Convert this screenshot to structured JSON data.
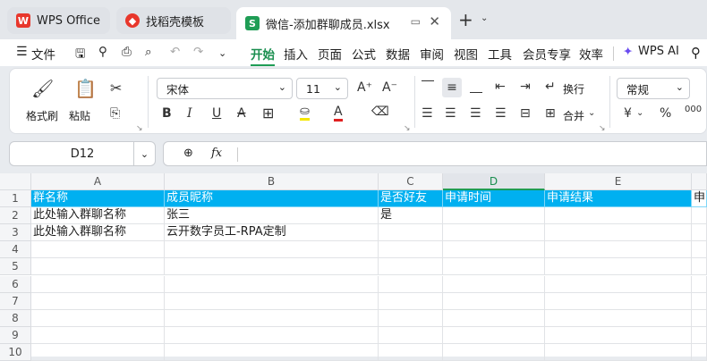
{
  "tabs": [
    {
      "label": "WPS Office",
      "icon": "wps-logo-icon"
    },
    {
      "label": "找稻壳模板",
      "icon": "docer-icon"
    },
    {
      "label": "微信-添加群聊成员.xlsx",
      "icon": "spreadsheet-icon",
      "icon_letter": "S"
    }
  ],
  "menu": {
    "file": "文件",
    "items": [
      "开始",
      "插入",
      "页面",
      "公式",
      "数据",
      "审阅",
      "视图",
      "工具",
      "会员专享",
      "效率"
    ],
    "wps_ai": "WPS AI"
  },
  "ribbon": {
    "format_painter": "格式刷",
    "paste": "粘贴",
    "font_name": "宋体",
    "font_size": "11",
    "wrap": "换行",
    "merge": "合并",
    "number_format": "常规",
    "bold": "B",
    "italic": "I",
    "underline": "U",
    "font_color_letter": "A",
    "currency": "¥",
    "percent": "%",
    "decimal": "000"
  },
  "formula": {
    "cell_ref": "D12",
    "fx": "fx",
    "value": ""
  },
  "grid": {
    "columns": [
      "A",
      "B",
      "C",
      "D",
      "E"
    ],
    "rows": [
      "1",
      "2",
      "3",
      "4",
      "5",
      "6",
      "7",
      "8",
      "9",
      "10"
    ],
    "header_row": [
      "群名称",
      "成员昵称",
      "是否好友",
      "申请时间",
      "申请结果",
      "申"
    ],
    "data": [
      [
        "此处输入群聊名称",
        "张三",
        "是",
        "",
        ""
      ],
      [
        "此处输入群聊名称",
        "云开数字员工-RPA定制",
        "",
        "",
        ""
      ]
    ]
  },
  "colors": {
    "header_fill": "#00b0f0",
    "accent_green": "#1f9d55",
    "wps_red": "#e8372c"
  }
}
